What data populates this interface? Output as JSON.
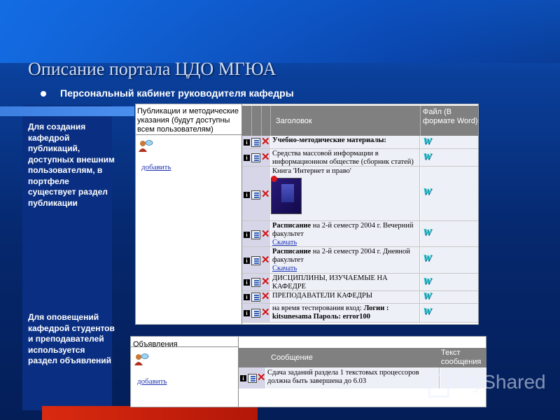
{
  "slide": {
    "title": "Описание портала ЦДО МГЮА",
    "subtitle": "Персональный кабинет руководителя кафедры",
    "side_text_1": "Для создания кафедрой публикаций, доступных внешним пользователям, в портфеле существует раздел публикации",
    "side_text_2": "Для оповещений кафедрой студентов и преподавателей используется раздел объявлений"
  },
  "publications": {
    "section_title": "Публикации и методические указания (будут доступны всем пользователям)",
    "add_link": "добавить",
    "col_title": "Заголовок",
    "col_file": "Файл (В формате Word)",
    "rows": [
      {
        "bold": "Учебно-методические материалы:",
        "text": "",
        "link": ""
      },
      {
        "bold": "",
        "text": "Средства массовой информации в информационном обществе (сборник статей)",
        "link": ""
      },
      {
        "bold": "",
        "text": "Книга 'Интернет и право'",
        "link": ""
      },
      {
        "bold": "Расписание",
        "text": " на 2-й семестр 2004 г. Вечерний факультет",
        "link": "Скачать"
      },
      {
        "bold": "Расписание",
        "text": " на 2-й семестр 2004 г. Дневной факультет",
        "link": "Скачать"
      },
      {
        "bold": "",
        "text": "ДИСЦИПЛИНЫ, ИЗУЧАЕМЫЕ НА КАФЕДРЕ",
        "link": ""
      },
      {
        "bold": "",
        "text": "ПРЕПОДАВАТЕЛИ КАФЕДРЫ",
        "link": ""
      },
      {
        "bold": "",
        "text": "на время тестирования вход: ",
        "bold2": "Логин : kitsunesama Пароль: error100",
        "link": ""
      }
    ]
  },
  "announcements": {
    "section_title": "Объявления",
    "add_link": "добавить",
    "col_message": "Сообщение",
    "col_text": "Текст сообщения",
    "rows": [
      {
        "text": "Сдача заданий раздела 1 текстовых процессоров должна быть завершена до 6.03"
      }
    ]
  },
  "watermark": "MyShared",
  "icons": {
    "info": "i",
    "delete": "✕",
    "word": "W"
  },
  "colors": {
    "accent": "#0a3f9a",
    "header_gray": "#808080",
    "delete_red": "#d41414",
    "word_cyan": "#19c8c8",
    "link_blue": "#1a2fb0"
  }
}
